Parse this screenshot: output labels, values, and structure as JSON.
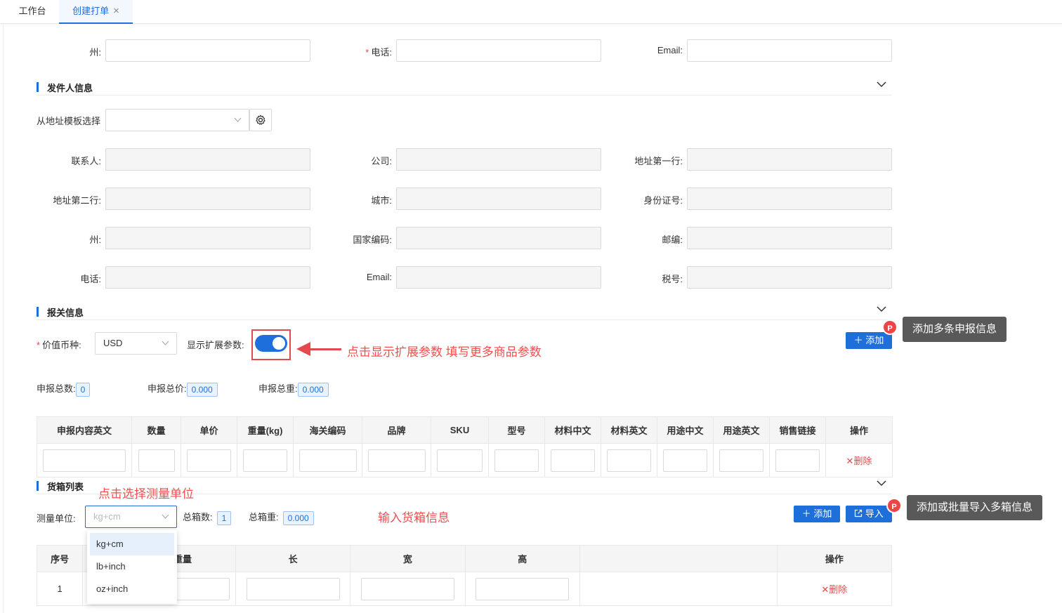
{
  "tabs": [
    {
      "label": "工作台"
    },
    {
      "label": "创建打单",
      "close": "×"
    }
  ],
  "receiver_tail": {
    "state_label": "州",
    "phone_label": "电话",
    "email_label": "Email"
  },
  "sender": {
    "section_title": "发件人信息",
    "template_label": "从地址模板选择",
    "fields": {
      "contact": "联系人",
      "company": "公司",
      "address1": "地址第一行",
      "address2": "地址第二行",
      "city": "城市",
      "id_number": "身份证号",
      "state": "州",
      "country_code": "国家编码",
      "zip": "邮编",
      "phone": "电话",
      "email": "Email",
      "tax_no": "税号"
    }
  },
  "customs": {
    "section_title": "报关信息",
    "currency_label": "价值币种",
    "currency_value": "USD",
    "ext_label": "显示扩展参数",
    "annotation_toggle": "点击显示扩展参数 填写更多商品参数",
    "add_button": "添加",
    "tooltip_add": "添加多条申报信息",
    "badge": "P",
    "stats": {
      "count_label": "申报总数",
      "count_value": "0",
      "price_label": "申报总价",
      "price_value": "0.000",
      "weight_label": "申报总重",
      "weight_value": "0.000"
    },
    "columns": [
      "申报内容英文",
      "数量",
      "单价",
      "重量(kg)",
      "海关编码",
      "品牌",
      "SKU",
      "型号",
      "材料中文",
      "材料英文",
      "用途中文",
      "用途英文",
      "销售链接",
      "操作"
    ],
    "delete_label": "删除"
  },
  "boxes": {
    "section_title": "货箱列表",
    "annotation_unit": "点击选择测量单位",
    "annotation_input": "输入货箱信息",
    "unit_label": "测量单位",
    "unit_value": "kg+cm",
    "total_boxes_label": "总箱数",
    "total_boxes_value": "1",
    "total_weight_label": "总箱重",
    "total_weight_value": "0.000",
    "add_button": "添加",
    "import_button": "导入",
    "tooltip_import": "添加或批量导入多箱信息",
    "badge": "P",
    "unit_options": [
      "kg+cm",
      "lb+inch",
      "oz+inch"
    ],
    "columns": [
      "序号",
      "重量",
      "长",
      "宽",
      "高",
      "",
      "操作"
    ],
    "rows": [
      {
        "index": "1"
      }
    ],
    "delete_label": "删除"
  },
  "colors": {
    "primary": "#1e6fd9",
    "danger": "#e5484d",
    "tooltip": "#595959"
  },
  "icons": [
    "close-icon",
    "chevron-down-icon",
    "gear-icon",
    "plus-icon",
    "import-icon",
    "arrow-left-icon"
  ]
}
